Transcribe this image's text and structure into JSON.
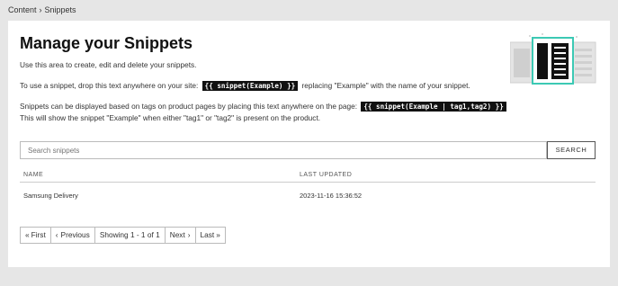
{
  "breadcrumb": {
    "root": "Content",
    "separator": "›",
    "current": "Snippets"
  },
  "header": {
    "title": "Manage your Snippets"
  },
  "intro": {
    "line1": "Use this area to create, edit and delete your snippets.",
    "line2_pre": "To use a snippet, drop this text anywhere on your site:",
    "line2_code": "{{ snippet(Example) }}",
    "line2_post": "replacing \"Example\" with the name of your snippet.",
    "line3_pre": "Snippets can be displayed based on tags on product pages by placing this text anywhere on the page:",
    "line3_code": "{{ snippet(Example | tag1,tag2) }}",
    "line4": "This will show the snippet \"Example\" when either \"tag1\" or \"tag2\" is present on the product."
  },
  "search": {
    "placeholder": "Search snippets",
    "button_label": "SEARCH"
  },
  "table": {
    "columns": [
      "NAME",
      "LAST UPDATED"
    ],
    "rows": [
      {
        "name": "Samsung Delivery",
        "last_updated": "2023-11-16 15:36:52"
      }
    ]
  },
  "pagination": {
    "first": "First",
    "first_icon": "«",
    "previous": "Previous",
    "previous_icon": "‹",
    "status": "Showing 1 - 1 of 1",
    "next": "Next",
    "next_icon": "›",
    "last": "Last",
    "last_icon": "»"
  },
  "colors": {
    "accent": "#3cc9b4",
    "code_bg": "#111111",
    "page_bg": "#e6e6e6"
  }
}
